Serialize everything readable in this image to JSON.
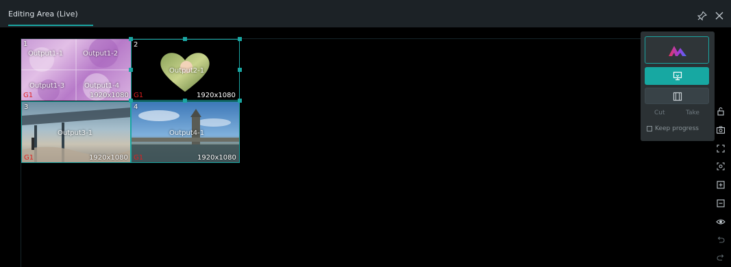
{
  "header": {
    "tab_title": "Editing Area (Live)",
    "pin_icon": "pin-icon",
    "close_icon": "close-icon"
  },
  "colors": {
    "accent": "#1aa6a2",
    "header_bg": "#1c2226",
    "panel_bg": "#2b3134",
    "group_label": "#e02020"
  },
  "windows": [
    {
      "number": "1",
      "group": "G1",
      "resolution": "1920x1080",
      "outputs": [
        "Output1-1",
        "Output1-2",
        "Output1-3",
        "Output1-4"
      ]
    },
    {
      "number": "2",
      "group": "G1",
      "resolution": "1920x1080",
      "outputs": [
        "Output2-1"
      ]
    },
    {
      "number": "3",
      "group": "G1",
      "resolution": "1920x1080",
      "outputs": [
        "Output3-1"
      ]
    },
    {
      "number": "4",
      "group": "G1",
      "resolution": "1920x1080",
      "outputs": [
        "Output4-1"
      ]
    }
  ],
  "control_panel": {
    "logo_icon": "brand-logo-icon",
    "live_icon": "screen-live-icon",
    "preview_icon": "film-preview-icon",
    "cut_label": "Cut",
    "take_label": "Take",
    "keep_progress_label": "Keep progress",
    "keep_progress_checked": false
  },
  "side_toolbar": [
    "unlock-icon",
    "screenshot-icon",
    "fit-screen-icon",
    "focus-icon",
    "add-layer-icon",
    "remove-layer-icon",
    "visibility-icon",
    "undo-icon",
    "redo-icon"
  ]
}
